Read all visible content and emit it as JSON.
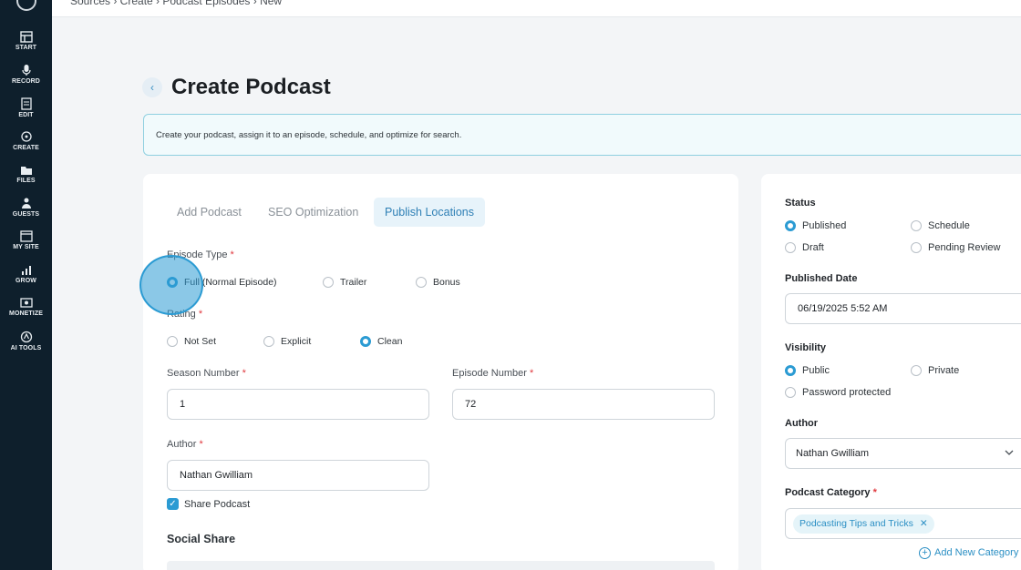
{
  "topbar": {
    "breadcrumb": "Sources  ›  Create  ›  Podcast Episodes  ›  New"
  },
  "sidebar": {
    "items": [
      {
        "label": "START",
        "icon": "layout-icon"
      },
      {
        "label": "RECORD",
        "icon": "microphone-icon"
      },
      {
        "label": "EDIT",
        "icon": "edit-icon"
      },
      {
        "label": "CREATE",
        "icon": "create-icon"
      },
      {
        "label": "FILES",
        "icon": "folder-icon"
      },
      {
        "label": "GUESTS",
        "icon": "guests-icon"
      },
      {
        "label": "MY SITE",
        "icon": "browser-icon"
      },
      {
        "label": "GROW",
        "icon": "chart-icon"
      },
      {
        "label": "MONETIZE",
        "icon": "monetize-icon"
      },
      {
        "label": "AI TOOLS",
        "icon": "ai-icon"
      }
    ]
  },
  "page": {
    "title": "Create Podcast",
    "info": "Create your podcast, assign it to an episode, schedule, and optimize for search."
  },
  "tabs": [
    {
      "label": "Add Podcast",
      "active": false
    },
    {
      "label": "SEO Optimization",
      "active": false
    },
    {
      "label": "Publish Locations",
      "active": true
    }
  ],
  "form": {
    "episode_type": {
      "label": "Episode Type",
      "options": [
        "Full (Normal Episode)",
        "Trailer",
        "Bonus"
      ],
      "selected": "Full (Normal Episode)"
    },
    "rating": {
      "label": "Rating",
      "options": [
        "Not Set",
        "Explicit",
        "Clean"
      ],
      "selected": "Clean"
    },
    "season_number": {
      "label": "Season Number",
      "value": "1"
    },
    "episode_number": {
      "label": "Episode Number",
      "value": "72"
    },
    "author": {
      "label": "Author",
      "value": "Nathan Gwilliam"
    },
    "share_podcast": {
      "label": "Share Podcast",
      "checked": true
    },
    "social_share_title": "Social Share"
  },
  "right": {
    "status": {
      "label": "Status",
      "options": [
        "Published",
        "Schedule",
        "Draft",
        "Pending Review"
      ],
      "selected": "Published"
    },
    "published_date": {
      "label": "Published Date",
      "value": "06/19/2025 5:52 AM"
    },
    "visibility": {
      "label": "Visibility",
      "options": [
        "Public",
        "Private",
        "Password protected"
      ],
      "selected": "Public"
    },
    "author": {
      "label": "Author",
      "value": "Nathan Gwilliam"
    },
    "category": {
      "label": "Podcast Category",
      "chip": "Podcasting Tips and Tricks",
      "add_label": "Add New Category"
    }
  },
  "colors": {
    "accent": "#2b9bd3",
    "sidebar": "#0e1f2c",
    "required": "#e0393e"
  }
}
